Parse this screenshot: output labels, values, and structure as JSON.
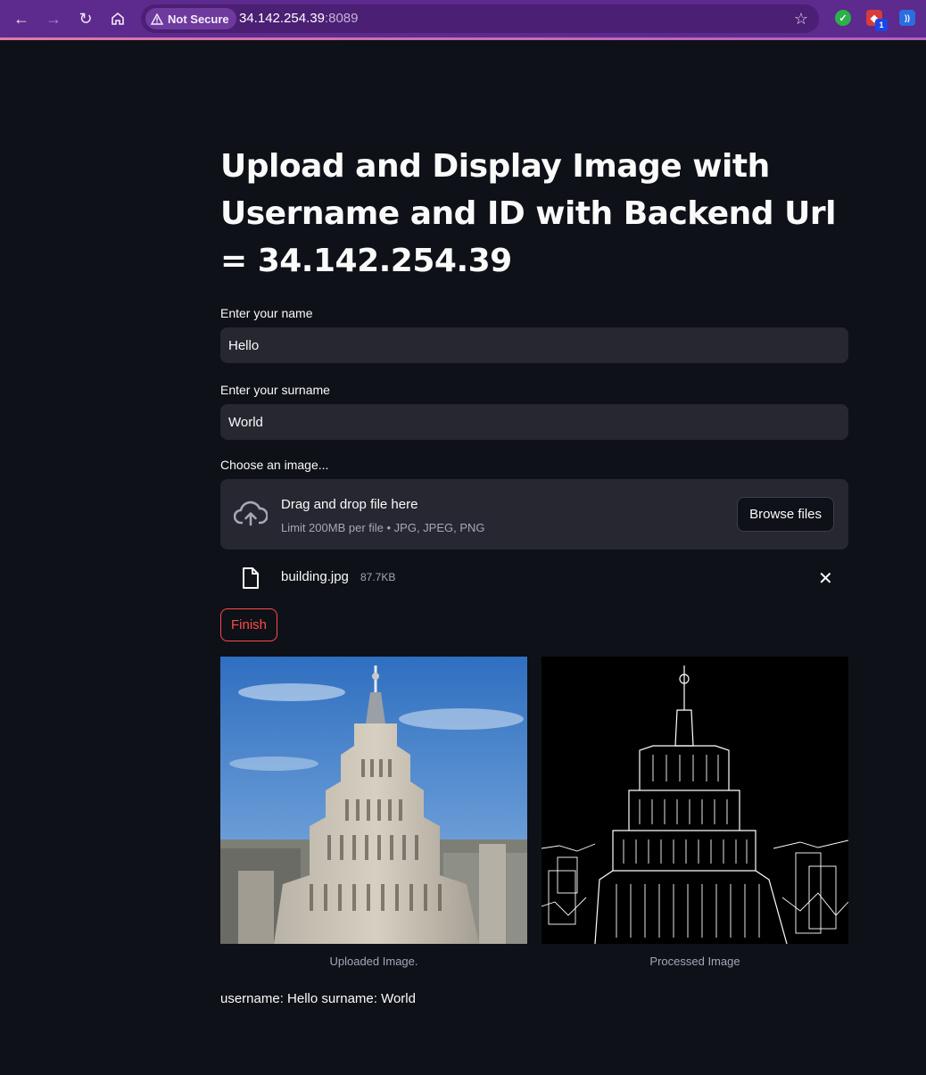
{
  "browser": {
    "security_label": "Not Secure",
    "url_host": "34.142.254.39",
    "url_port": ":8089",
    "extension_badge": "1"
  },
  "page": {
    "title": "Upload and Display Image with Username and ID with Backend Url = 34.142.254.39",
    "name_label": "Enter your name",
    "name_value": "Hello",
    "surname_label": "Enter your surname",
    "surname_value": "World",
    "uploader_label": "Choose an image...",
    "dropzone_title": "Drag and drop file here",
    "dropzone_limits": "Limit 200MB per file • JPG, JPEG, PNG",
    "browse_label": "Browse files",
    "uploaded_file": {
      "name": "building.jpg",
      "size": "87.7KB"
    },
    "finish_label": "Finish",
    "left_caption": "Uploaded Image.",
    "right_caption": "Processed Image",
    "result_text": "username: Hello surname: World"
  },
  "colors": {
    "background": "#0e1117",
    "input_bg": "#262730",
    "accent_red": "#ff4b4b",
    "browser_purple": "#5d2a8e"
  }
}
